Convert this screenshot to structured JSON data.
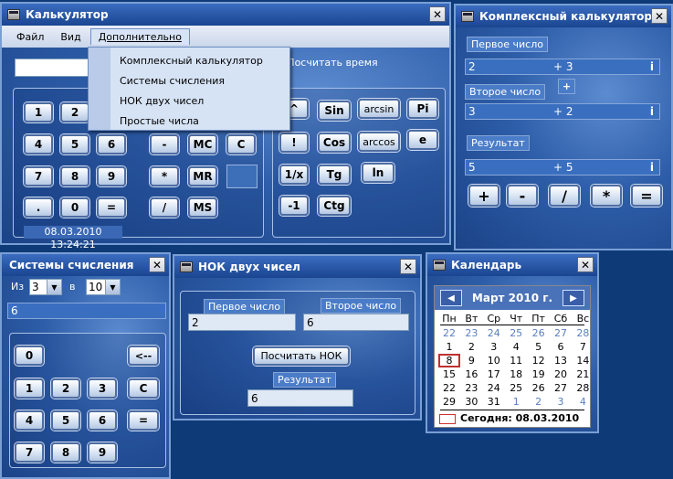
{
  "calc": {
    "title": "Калькулятор",
    "menu": [
      "Файл",
      "Вид",
      "Дополнительно"
    ],
    "dropdown": [
      "Комплексный калькулятор",
      "Системы счисления",
      "НОК двух чисел",
      "Простые числа"
    ],
    "display": "",
    "time_button": "Посчитать время",
    "datetime": "08.03.2010 13:24:21",
    "keys": {
      "k1": "1",
      "k2": "2",
      "k4": "4",
      "k5": "5",
      "k6": "6",
      "k7": "7",
      "k8": "8",
      "k9": "9",
      "kdot": ".",
      "k0": "0",
      "keq": "=",
      "kminus": "-",
      "kmul": "*",
      "kdiv": "/",
      "mc": "MC",
      "mr": "MR",
      "ms": "MS",
      "c": "C"
    },
    "sci": {
      "pow": "^",
      "fact": "!",
      "inv": "1/x",
      "neg": "-1",
      "sin": "Sin",
      "cos": "Cos",
      "tg": "Tg",
      "ctg": "Ctg",
      "arcsin": "arcsin",
      "arccos": "arccos",
      "ln": "ln",
      "pi": "Pi",
      "e": "e"
    }
  },
  "complex": {
    "title": "Комплексный калькулятор",
    "first_label": "Первое число",
    "second_label": "Второе число",
    "result_label": "Результат",
    "a_re": "2",
    "a_op": "+ 3",
    "a_i": "i",
    "op_sign": "+",
    "b_re": "3",
    "b_op": "+ 2",
    "b_i": "i",
    "r_re": "5",
    "r_op": "+ 5",
    "r_i": "i",
    "ops": [
      "+",
      "-",
      "/",
      "*",
      "="
    ]
  },
  "numsys": {
    "title": "Системы счисления",
    "from_label": "Из",
    "from_val": "3",
    "to_label": "в",
    "to_val": "10",
    "value": "6",
    "keys": {
      "k0": "0",
      "back": "<--",
      "k1": "1",
      "k2": "2",
      "k3": "3",
      "c": "C",
      "k4": "4",
      "k5": "5",
      "k6": "6",
      "eq": "=",
      "k7": "7",
      "k8": "8",
      "k9": "9"
    }
  },
  "lcm": {
    "title": "НОК двух чисел",
    "first_label": "Первое число",
    "second_label": "Второе число",
    "first_val": "2",
    "second_val": "6",
    "button": "Посчитать НОК",
    "result_label": "Результат",
    "result_val": "6"
  },
  "calendar": {
    "title": "Календарь",
    "month": "Март 2010 г.",
    "prev": "◀",
    "next": "▶",
    "weekdays": [
      "Пн",
      "Вт",
      "Ср",
      "Чт",
      "Пт",
      "Сб",
      "Вс"
    ],
    "weeks": [
      [
        "22",
        "23",
        "24",
        "25",
        "26",
        "27",
        "28"
      ],
      [
        "1",
        "2",
        "3",
        "4",
        "5",
        "6",
        "7"
      ],
      [
        "8",
        "9",
        "10",
        "11",
        "12",
        "13",
        "14"
      ],
      [
        "15",
        "16",
        "17",
        "18",
        "19",
        "20",
        "21"
      ],
      [
        "22",
        "23",
        "24",
        "25",
        "26",
        "27",
        "28"
      ],
      [
        "29",
        "30",
        "31",
        "1",
        "2",
        "3",
        "4"
      ]
    ],
    "today_label": "Сегодня: 08.03.2010"
  },
  "colors": {
    "accent": "#2b5fae",
    "titlebar": "#1a4590"
  }
}
